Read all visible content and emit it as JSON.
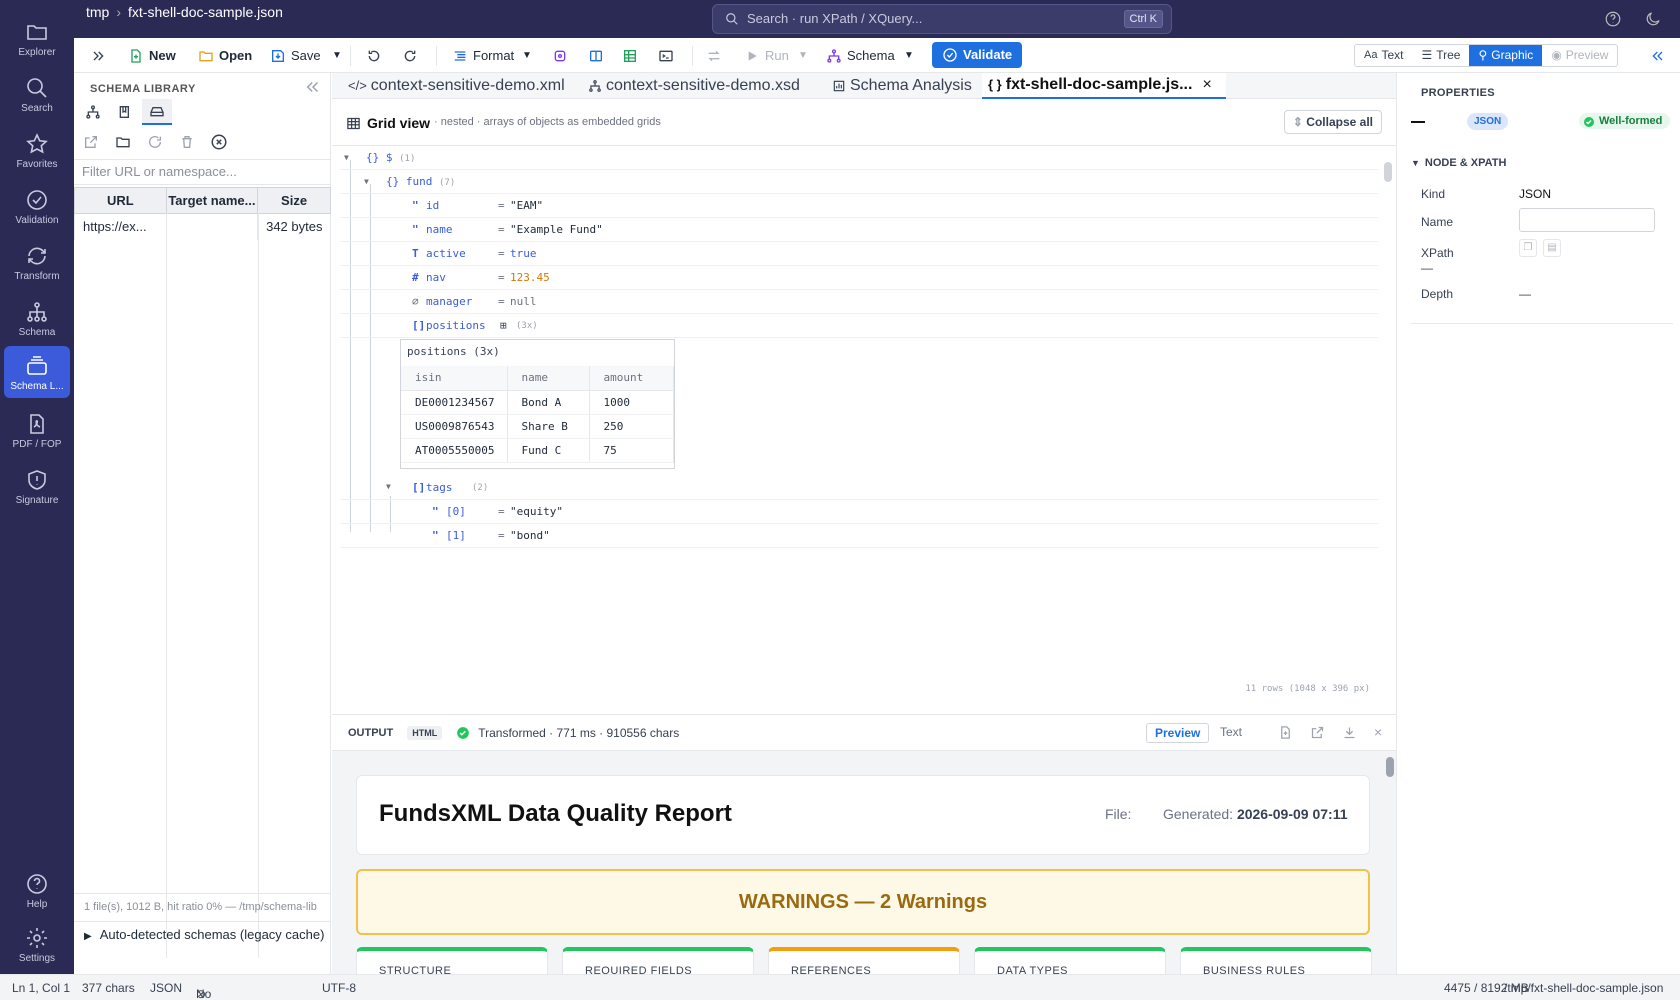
{
  "sidebar": {
    "items": [
      {
        "label": "Explorer",
        "icon": "folder-icon"
      },
      {
        "label": "Search",
        "icon": "search-icon"
      },
      {
        "label": "Favorites",
        "icon": "star-icon"
      },
      {
        "label": "Validation",
        "icon": "check-circle-icon"
      },
      {
        "label": "Transform",
        "icon": "refresh-icon"
      },
      {
        "label": "Schema",
        "icon": "hierarchy-icon"
      },
      {
        "label": "Schema L...",
        "icon": "layers-icon",
        "active": true
      },
      {
        "label": "PDF / FOP",
        "icon": "pdf-icon"
      },
      {
        "label": "Signature",
        "icon": "shield-icon"
      }
    ],
    "help": "Help",
    "settings": "Settings"
  },
  "topbar": {
    "crumb_root": "tmp",
    "crumb_file": "fxt-shell-doc-sample.json",
    "search_placeholder": "Search · run XPath / XQuery...",
    "search_shortcut": "Ctrl K"
  },
  "toolbar": {
    "new": "New",
    "open": "Open",
    "save": "Save",
    "format": "Format",
    "run": "Run",
    "schema": "Schema",
    "validate": "Validate",
    "view_text": "Text",
    "view_tree": "Tree",
    "view_graphic": "Graphic",
    "view_preview": "Preview"
  },
  "schema_library": {
    "title": "SCHEMA LIBRARY",
    "filter_placeholder": "Filter URL or namespace...",
    "columns": [
      "URL",
      "Target name...",
      "Size"
    ],
    "rows": [
      [
        "https://ex...",
        "",
        "342 bytes"
      ]
    ],
    "status": "1 file(s), 1012 B, hit ratio 0%  —  /tmp/schema-lib",
    "auto_detected": "Auto-detected schemas (legacy cache)"
  },
  "tabs": [
    {
      "label": "context-sensitive-demo.xml",
      "icon": "code-icon"
    },
    {
      "label": "context-sensitive-demo.xsd",
      "icon": "hierarchy-icon"
    },
    {
      "label": "Schema Analysis",
      "icon": "chart-icon"
    },
    {
      "label": "fxt-shell-doc-sample.js...",
      "icon": "braces-icon",
      "active": true
    }
  ],
  "grid": {
    "title": "Grid view",
    "subtitle": "· nested · arrays of objects as embedded grids",
    "collapse_all": "Collapse all",
    "root": {
      "sym": "{}",
      "key": "$",
      "count": "(1)"
    },
    "fund": {
      "sym": "{}",
      "key": "fund",
      "count": "(7)"
    },
    "fields": [
      {
        "sym": "\"",
        "key": "id",
        "value": "\"EAM\"",
        "type": "str"
      },
      {
        "sym": "\"",
        "key": "name",
        "value": "\"Example Fund\"",
        "type": "str"
      },
      {
        "sym": "T",
        "key": "active",
        "value": "true",
        "type": "bool"
      },
      {
        "sym": "#",
        "key": "nav",
        "value": "123.45",
        "type": "num"
      },
      {
        "sym": "∅",
        "key": "manager",
        "value": "null",
        "type": "nul"
      }
    ],
    "positions": {
      "sym": "[]",
      "key": "positions",
      "count": "(3x)"
    },
    "embedded": {
      "title": "positions (3x)",
      "columns": [
        "isin",
        "name",
        "amount"
      ],
      "rows": [
        [
          "DE0001234567",
          "Bond A",
          "1000"
        ],
        [
          "US0009876543",
          "Share B",
          "250"
        ],
        [
          "AT0005550005",
          "Fund C",
          "75"
        ]
      ]
    },
    "tags": {
      "sym": "[]",
      "key": "tags",
      "count": "(2)"
    },
    "tag_items": [
      {
        "sym": "\"",
        "key": "[0]",
        "value": "\"equity\""
      },
      {
        "sym": "\"",
        "key": "[1]",
        "value": "\"bond\""
      }
    ],
    "footer": "11 rows (1048 x 396 px)"
  },
  "output": {
    "label": "OUTPUT",
    "format": "HTML",
    "status": "Transformed · 771 ms · 910556 chars",
    "preview": "Preview",
    "text": "Text",
    "report_title": "FundsXML Data Quality Report",
    "file_label": "File:",
    "generated_label": "Generated:",
    "generated_value": "2026-09-09 07:11",
    "warnings": "WARNINGS — 2 Warnings",
    "categories": [
      {
        "label": "STRUCTURE",
        "color": "#22c55e"
      },
      {
        "label": "REQUIRED FIELDS",
        "color": "#22c55e"
      },
      {
        "label": "REFERENCES",
        "color": "#f59e0b"
      },
      {
        "label": "DATA TYPES",
        "color": "#22c55e"
      },
      {
        "label": "BUSINESS RULES",
        "color": "#22c55e"
      }
    ]
  },
  "properties": {
    "title": "PROPERTIES",
    "type_badge": "JSON",
    "wellformed": "Well-formed",
    "section": "NODE & XPATH",
    "kind_label": "Kind",
    "kind_value": "JSON",
    "name_label": "Name",
    "xpath_label": "XPath",
    "xpath_value": "—",
    "depth_label": "Depth",
    "depth_value": "—"
  },
  "statusbar": {
    "position": "Ln 1, Col 1",
    "chars": "377 chars",
    "lang": "JSON",
    "schema": "No JSON Schema",
    "encoding": "UTF-8",
    "memory": "4475 / 8192 MB",
    "path": "/tmp/fxt-shell-doc-sample.json"
  },
  "colors": {
    "accent": "#1e6fe0",
    "sidebar": "#2a2a55",
    "success": "#22c55e",
    "warning": "#f0c24a"
  }
}
